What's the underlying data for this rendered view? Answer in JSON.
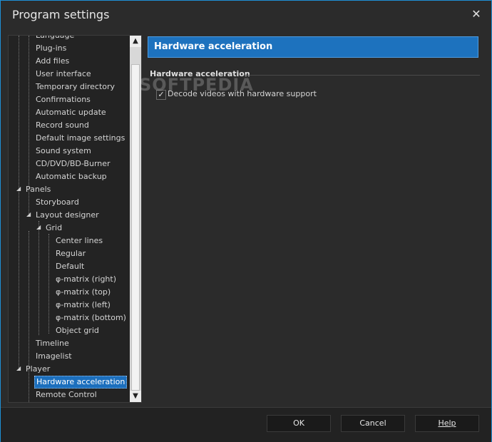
{
  "window": {
    "title": "Program settings"
  },
  "tree": {
    "items": [
      {
        "label": "Language"
      },
      {
        "label": "Plug-ins"
      },
      {
        "label": "Add files"
      },
      {
        "label": "User interface"
      },
      {
        "label": "Temporary directory"
      },
      {
        "label": "Confirmations"
      },
      {
        "label": "Automatic update"
      },
      {
        "label": "Record sound"
      },
      {
        "label": "Default image settings"
      },
      {
        "label": "Sound system"
      },
      {
        "label": "CD/DVD/BD-Burner"
      },
      {
        "label": "Automatic backup"
      },
      {
        "label": "Panels"
      },
      {
        "label": "Storyboard"
      },
      {
        "label": "Layout designer"
      },
      {
        "label": "Grid"
      },
      {
        "label": "Center lines"
      },
      {
        "label": "Regular"
      },
      {
        "label": "Default"
      },
      {
        "label": "φ-matrix (right)"
      },
      {
        "label": "φ-matrix (top)"
      },
      {
        "label": "φ-matrix (left)"
      },
      {
        "label": "φ-matrix (bottom)"
      },
      {
        "label": "Object grid"
      },
      {
        "label": "Timeline"
      },
      {
        "label": "Imagelist"
      },
      {
        "label": "Player"
      },
      {
        "label": "Hardware acceleration"
      },
      {
        "label": "Remote Control"
      }
    ]
  },
  "content": {
    "header": "Hardware acceleration",
    "group_title": "Hardware acceleration",
    "checkbox_label": "Decode videos with hardware support",
    "checkbox_checked": true,
    "watermark": "SOFTPEDIA"
  },
  "footer": {
    "ok": "OK",
    "cancel": "Cancel",
    "help": "Help"
  },
  "colors": {
    "accent": "#1d72be",
    "border": "#1e90d6",
    "background": "#2b2b2b"
  }
}
